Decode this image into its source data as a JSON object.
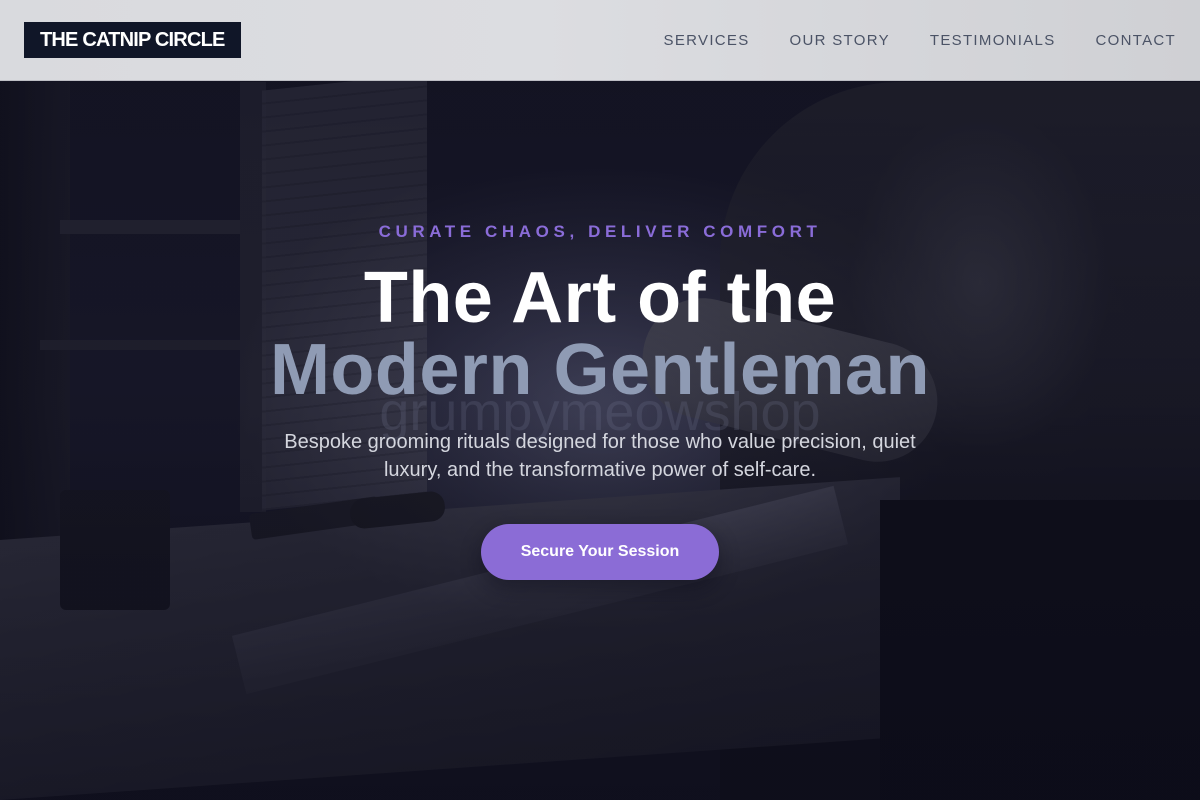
{
  "brand": {
    "name": "THE CATNIP CIRCLE"
  },
  "nav": {
    "items": [
      {
        "label": "SERVICES"
      },
      {
        "label": "OUR STORY"
      },
      {
        "label": "TESTIMONIALS"
      },
      {
        "label": "CONTACT"
      }
    ]
  },
  "hero": {
    "eyebrow": "CURATE CHAOS, DELIVER COMFORT",
    "headline_line1": "The Art of the",
    "headline_line2": "Modern Gentleman",
    "watermark": "grumpymeowshop",
    "subtitle": "Bespoke grooming rituals designed for those who value precision, quiet luxury, and the transformative power of self-care.",
    "cta_label": "Secure Your Session"
  },
  "colors": {
    "accent": "#8b6cd6",
    "logo_bg": "#101628",
    "nav_bg": "#d9dade",
    "headline_secondary": "#8f9bb4"
  }
}
